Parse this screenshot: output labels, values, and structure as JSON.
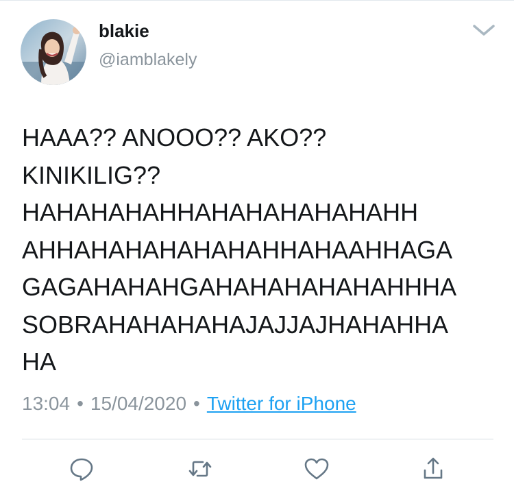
{
  "tweet": {
    "author": {
      "display_name": "blakie",
      "handle": "@iamblakely",
      "avatar_icon": "profile-photo"
    },
    "text_lines": [
      "HAAA?? ANOOO?? AKO??",
      "KINIKILIG??",
      "HAHAHAHAHHAHAHAHAHAHAHH",
      "AHHAHAHAHAHAHAHHAHAAHHAGA",
      "GAGAHAHAHGAHAHAHAHAHAHHHA",
      "SOBRAHAHAHAHAJAJJAJHAHAHHA",
      "HA"
    ],
    "time": "13:04",
    "date": "15/04/2020",
    "separator": "•",
    "source": "Twitter for iPhone"
  },
  "menu_icon": "chevron-down-icon",
  "actions": [
    {
      "icon": "reply-icon"
    },
    {
      "icon": "retweet-icon"
    },
    {
      "icon": "like-icon"
    },
    {
      "icon": "share-icon"
    }
  ],
  "colors": {
    "text": "#14171a",
    "secondary": "#8a949c",
    "link": "#1da1f2",
    "divider": "#d6dde3"
  }
}
